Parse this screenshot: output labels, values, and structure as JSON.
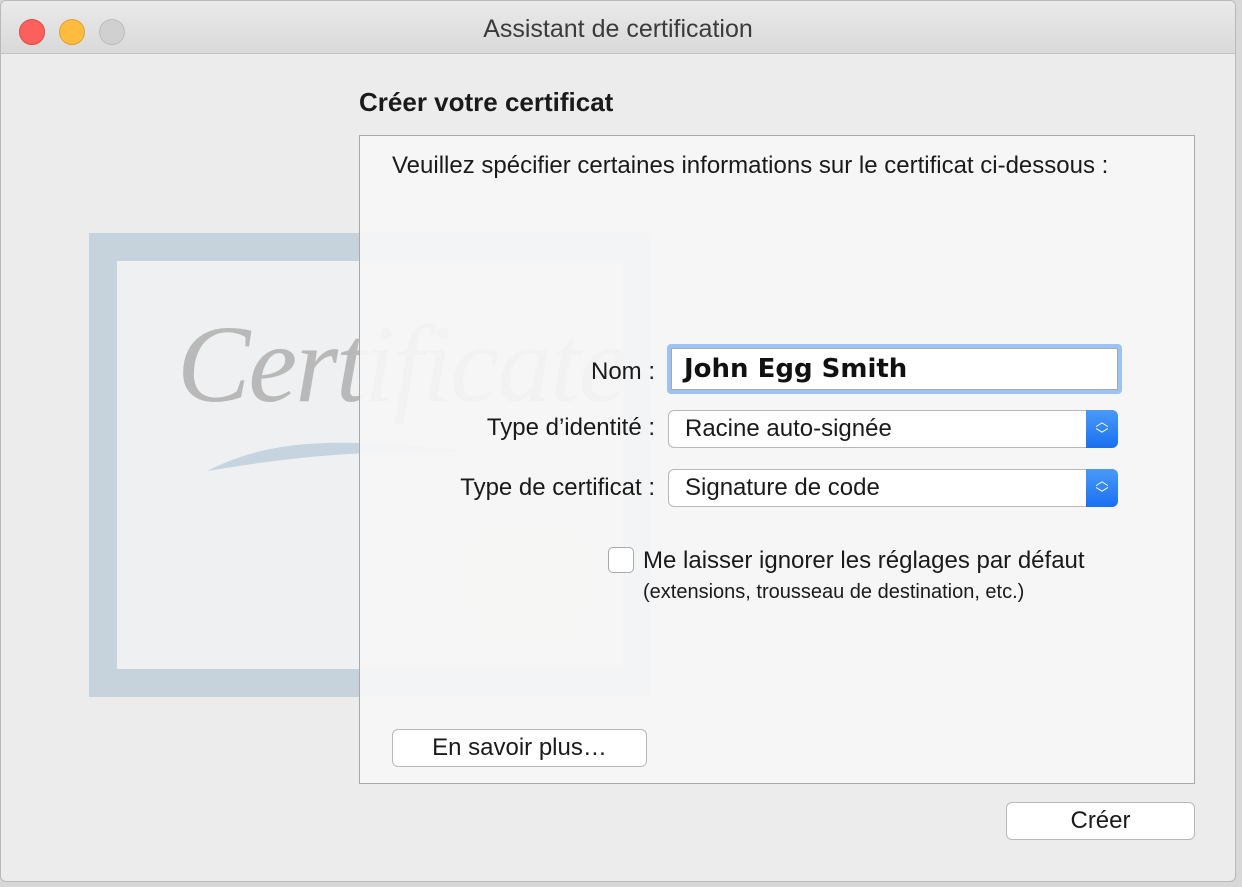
{
  "window": {
    "title": "Assistant de certification"
  },
  "heading": "Créer votre certificat",
  "illustration": {
    "script_text": "Certificate"
  },
  "intro": "Veuillez spécifier certaines informations sur le certificat ci-dessous :",
  "form": {
    "name_label": "Nom :",
    "name_value": "John Egg Smith",
    "identity_label": "Type d’identité :",
    "identity_value": "Racine auto-signée",
    "cert_type_label": "Type de certificat :",
    "cert_type_value": "Signature de code",
    "override_label": "Me laisser ignorer les réglages par défaut",
    "override_sub": "(extensions, trousseau de destination, etc.)",
    "override_checked": false
  },
  "buttons": {
    "learn_more": "En savoir plus…",
    "create": "Créer"
  },
  "colors": {
    "close": "#fc605c",
    "minimize": "#fdbc40",
    "accent": "#1a6ff0",
    "focus_ring": "#9cc3f5"
  },
  "icons": {
    "close": "close-icon",
    "minimize": "minimize-icon",
    "zoom": "zoom-icon",
    "popup_arrows": "chevron-up-down-icon"
  }
}
